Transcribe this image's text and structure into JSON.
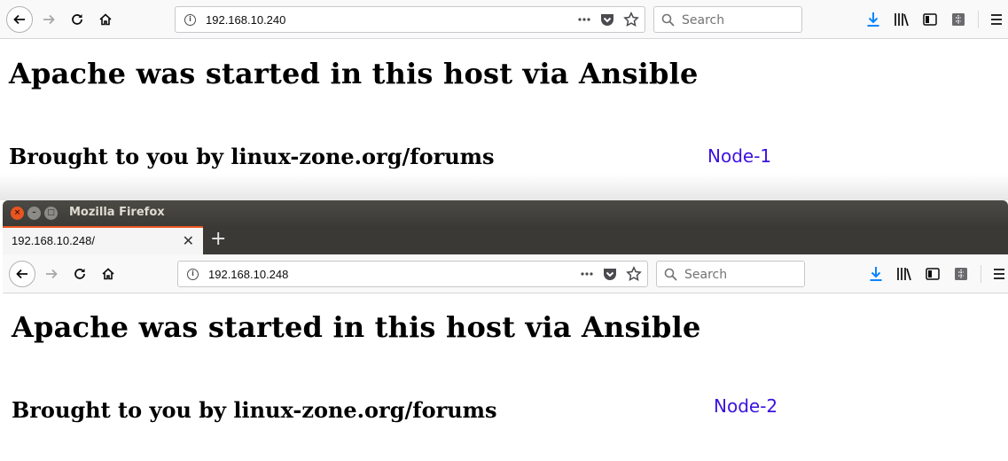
{
  "window_top": {
    "url": "192.168.10.240",
    "search_placeholder": "Search",
    "heading": "Apache was started in this host via Ansible",
    "subheading": "Brought to you by linux-zone.org/forums",
    "node_label": "Node-1"
  },
  "window_bottom": {
    "title": "Mozilla Firefox",
    "tab_label": "192.168.10.248/",
    "url": "192.168.10.248",
    "search_placeholder": "Search",
    "heading": "Apache was started in this host via Ansible",
    "subheading": "Brought to you by linux-zone.org/forums",
    "node_label": "Node-2"
  },
  "colors": {
    "link_blue": "#3b12e0",
    "download_blue": "#0a84ff",
    "ubuntu_orange": "#e95420",
    "titlebar": "#3b3a36"
  },
  "icons": [
    "back-arrow-icon",
    "forward-arrow-icon",
    "reload-icon",
    "home-icon",
    "info-icon",
    "more-actions-icon",
    "pocket-icon",
    "bookmark-star-icon",
    "search-icon",
    "download-icon",
    "library-icon",
    "sidebar-icon",
    "screenshot-icon",
    "menu-icon"
  ]
}
